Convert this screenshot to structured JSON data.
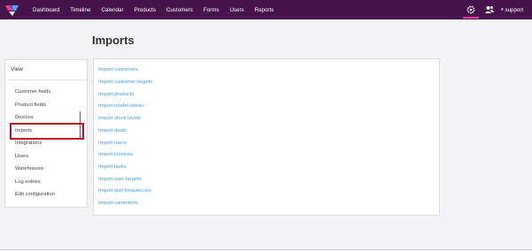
{
  "nav": {
    "items": [
      "Dashboard",
      "Timeline",
      "Calendar",
      "Products",
      "Customers",
      "Forms",
      "Users",
      "Reports"
    ],
    "user_label": "support"
  },
  "page": {
    "title": "Imports"
  },
  "sidebar": {
    "heading": "View",
    "items": [
      "Customer fields",
      "Product fields",
      "Devices",
      "Imports",
      "Integrations",
      "Users",
      "Warehouses",
      "Log entries",
      "Edit configuration"
    ]
  },
  "imports": {
    "links": [
      "Import customers",
      "Import customer targets",
      "Import products",
      "Import model stocks",
      "Import stock levels",
      "Import deals",
      "Import users",
      "Import invoices",
      "Import tasks",
      "Import user targets",
      "Import visit frequencies",
      "Import comments"
    ]
  },
  "colors": {
    "topbar": "#46134d",
    "accent": "#e13a9d",
    "link": "#3f9fe0",
    "highlight": "#c1121f"
  },
  "icons": [
    "logo-icon",
    "gear-icon",
    "users-icon",
    "caret-down-icon"
  ]
}
